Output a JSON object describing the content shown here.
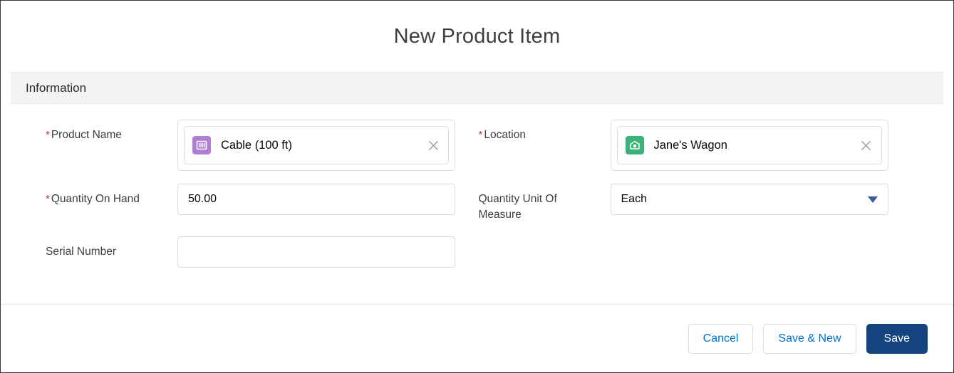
{
  "modal": {
    "title": "New Product Item",
    "section": {
      "title": "Information"
    },
    "fields": {
      "product_name": {
        "label": "Product Name",
        "required_marker": "*",
        "value": "Cable (100 ft)",
        "icon": "product-icon",
        "clear_icon": "close-icon"
      },
      "location": {
        "label": "Location",
        "required_marker": "*",
        "value": "Jane's Wagon",
        "icon": "location-icon",
        "clear_icon": "close-icon"
      },
      "quantity_on_hand": {
        "label": "Quantity On Hand",
        "required_marker": "*",
        "value": "50.00",
        "placeholder": ""
      },
      "quantity_unit_of_measure": {
        "label": "Quantity Unit Of Measure",
        "value": "Each",
        "arrow_icon": "chevron-down-icon"
      },
      "serial_number": {
        "label": "Serial Number",
        "value": "",
        "placeholder": ""
      }
    },
    "footer": {
      "cancel_label": "Cancel",
      "save_and_new_label": "Save & New",
      "save_label": "Save"
    }
  },
  "colors": {
    "brand_blue": "#14447e",
    "link_blue": "#0070d2",
    "required_red": "#c23934",
    "product_icon_purple": "#b07fd4",
    "location_icon_green": "#3bb277",
    "section_band_gray": "#f3f3f3",
    "border_gray": "#dddbda"
  }
}
